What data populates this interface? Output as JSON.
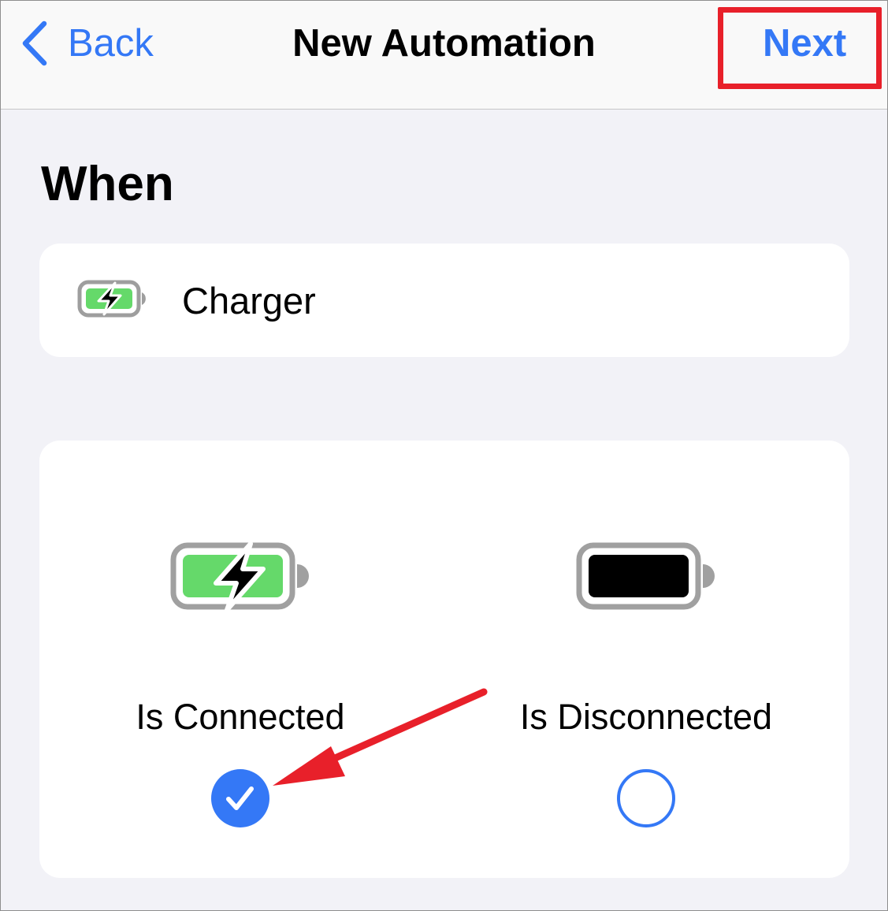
{
  "nav": {
    "back_label": "Back",
    "title": "New Automation",
    "next_label": "Next"
  },
  "section_heading": "When",
  "trigger": {
    "label": "Charger",
    "icon": "battery-charging-icon"
  },
  "options": [
    {
      "label": "Is Connected",
      "icon": "battery-charging-icon",
      "selected": true
    },
    {
      "label": "Is Disconnected",
      "icon": "battery-full-icon",
      "selected": false
    }
  ],
  "colors": {
    "accent": "#3478f6",
    "background": "#f2f2f7",
    "card": "#ffffff",
    "battery_green": "#65d96a",
    "highlight_red": "#e8202a"
  }
}
